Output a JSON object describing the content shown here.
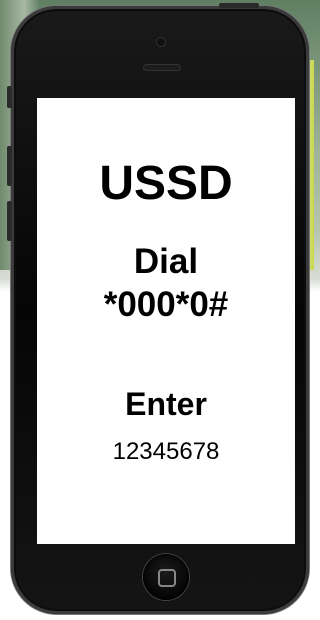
{
  "screen": {
    "title": "USSD",
    "dial_label": "Dial",
    "dial_code": "*000*0#",
    "enter_label": "Enter",
    "enter_code": "12345678"
  },
  "icons": {
    "camera": "front-camera-icon",
    "speaker": "earpiece-speaker-icon",
    "home": "home-button-icon"
  },
  "colors": {
    "screen_bg": "#ffffff",
    "phone_body": "#0a0a0a",
    "text": "#000000"
  }
}
